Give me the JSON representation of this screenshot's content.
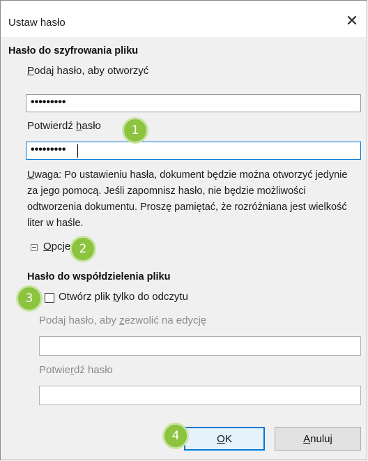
{
  "dialog": {
    "title": "Ustaw hasło",
    "close_glyph": "✕"
  },
  "encrypt": {
    "section_title": "Hasło do szyfrowania pliku",
    "enter_label_u": "P",
    "enter_label_rest": "odaj hasło, aby otworzyć",
    "enter_value": "•••••••••",
    "confirm_label_a": "Potwierdź ",
    "confirm_label_u": "h",
    "confirm_label_b": "asło",
    "confirm_value": "•••••••••"
  },
  "note": {
    "u": "U",
    "text": "waga: Po ustawieniu hasła, dokument będzie można otworzyć jedynie za jego pomocą. Jeśli zapomnisz hasło, nie będzie możliwości odtworzenia dokumentu. Proszę pamiętać, że rozróżniana jest wielkość liter w haśle."
  },
  "options": {
    "label_u": "O",
    "label_rest": "pcje"
  },
  "share": {
    "section_title": "Hasło do współdzielenia pliku",
    "readonly_a": "Otwórz plik ",
    "readonly_u": "t",
    "readonly_b": "ylko do odczytu",
    "readonly_checked": false,
    "edit_label_a": "Podaj hasło, aby ",
    "edit_label_u": "z",
    "edit_label_b": "ezwolić na edycję",
    "edit_value": "",
    "confirm_label_a": "Potwie",
    "confirm_label_u": "r",
    "confirm_label_b": "dź hasło",
    "confirm_value": ""
  },
  "buttons": {
    "ok_u": "O",
    "ok_rest": "K",
    "cancel_u": "A",
    "cancel_rest": "nuluj"
  },
  "callouts": [
    "1",
    "2",
    "3",
    "4"
  ],
  "colors": {
    "callout": "#8cc43f",
    "focus": "#0078d7"
  }
}
